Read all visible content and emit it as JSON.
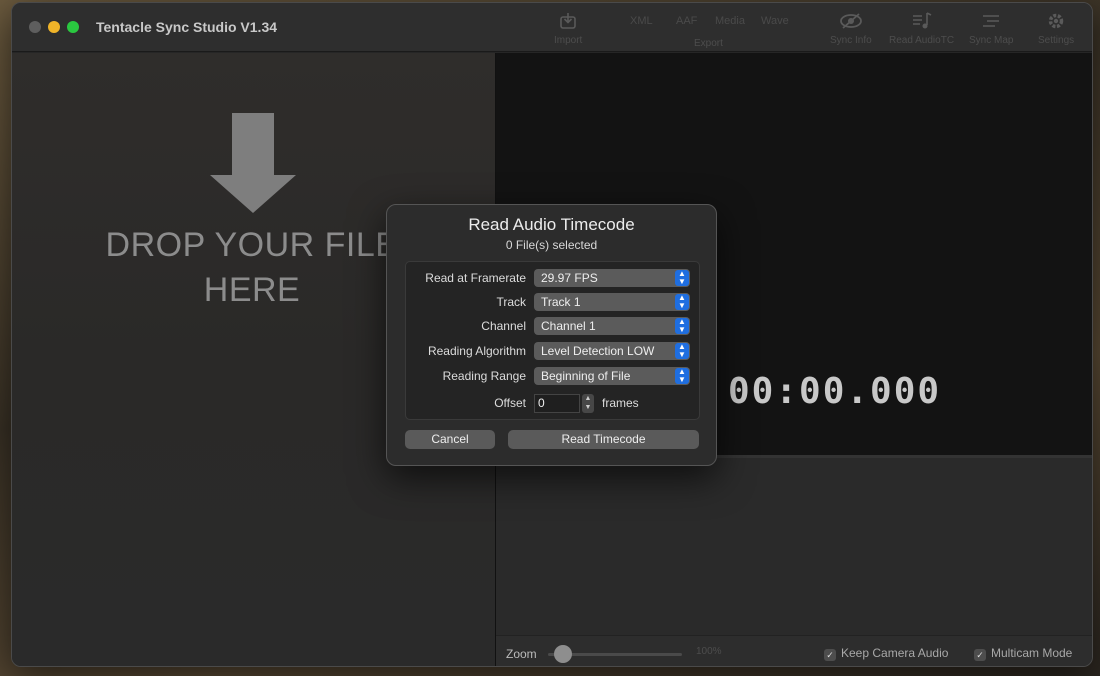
{
  "window": {
    "title": "Tentacle Sync Studio V1.34"
  },
  "toolbar": {
    "import": {
      "label": "Import",
      "icon": "import-icon"
    },
    "export": {
      "label": "Export",
      "items": [
        "XML",
        "AAF",
        "Media",
        "Wave"
      ]
    },
    "sync_info": {
      "label": "Sync Info",
      "icon": "eye-slash-icon"
    },
    "read_audio_tc": {
      "label": "Read AudioTC",
      "icon": "music-note-lines-icon"
    },
    "sync_map": {
      "label": "Sync Map",
      "icon": "lines-icon"
    },
    "settings": {
      "label": "Settings",
      "icon": "gear-icon"
    }
  },
  "drop_zone": {
    "text": "DROP YOUR FILE\nHERE"
  },
  "preview": {
    "timecode": "00:00.000"
  },
  "bottom_bar": {
    "zoom_label": "Zoom",
    "zoom_value": "100%",
    "keep_camera_audio": "Keep Camera Audio",
    "multicam_mode": "Multicam Mode",
    "check_mark": "✓"
  },
  "dialog": {
    "title": "Read Audio Timecode",
    "subtitle": "0 File(s) selected",
    "fields": [
      {
        "label": "Read at Framerate",
        "value": "29.97 FPS"
      },
      {
        "label": "Track",
        "value": "Track 1"
      },
      {
        "label": "Channel",
        "value": "Channel 1"
      },
      {
        "label": "Reading Algorithm",
        "value": "Level Detection LOW"
      },
      {
        "label": "Reading Range",
        "value": "Beginning of File"
      }
    ],
    "offset": {
      "label": "Offset",
      "value": "0",
      "unit": "frames"
    },
    "cancel_label": "Cancel",
    "read_label": "Read Timecode"
  },
  "colors": {
    "accent": "#1f6ee0",
    "close": "#5e5e5e",
    "minimize": "#f0b429",
    "maximize": "#2ac840"
  }
}
